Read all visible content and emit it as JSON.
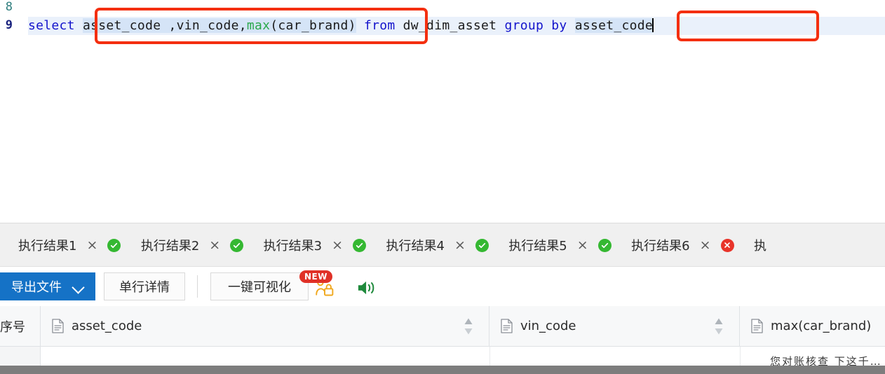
{
  "editor": {
    "line_numbers": [
      "8",
      "9"
    ],
    "sql": {
      "kw_select": "select",
      "col_asset_selected": "asset_code",
      "cols_mid": " ,vin_code,",
      "fn_max": "max",
      "max_args": "(car_brand)",
      "kw_from": "from",
      "table": "dw_dim_asset",
      "kw_group_by": "group by",
      "group_col": "asset_code"
    },
    "annotations": [
      {
        "name": "select-columns-highlight"
      },
      {
        "name": "group-by-column-highlight"
      }
    ]
  },
  "result_tabs": [
    {
      "label": "执行结果1",
      "close": "×",
      "status": "ok"
    },
    {
      "label": "执行结果2",
      "close": "×",
      "status": "ok"
    },
    {
      "label": "执行结果3",
      "close": "×",
      "status": "ok"
    },
    {
      "label": "执行结果4",
      "close": "×",
      "status": "ok"
    },
    {
      "label": "执行结果5",
      "close": "×",
      "status": "ok"
    },
    {
      "label": "执行结果6",
      "close": "×",
      "status": "err"
    },
    {
      "label": "执",
      "close": "",
      "status": "none"
    }
  ],
  "toolbar": {
    "export_label": "导出文件",
    "detail_label": "单行详情",
    "visualize_label": "一键可视化",
    "new_badge": "NEW",
    "lock_icon": "lock-person-icon",
    "speaker_icon": "speaker-icon"
  },
  "grid": {
    "index_header": "序号",
    "columns": [
      {
        "name": "asset_code",
        "sortable": true
      },
      {
        "name": "vin_code",
        "sortable": true
      },
      {
        "name": "max(car_brand)",
        "sortable": false
      }
    ],
    "rows": [
      {
        "asset_code": "",
        "vin_code": "",
        "max_car_brand": ""
      }
    ]
  },
  "watermark": {
    "text": "您对账核查 下这千…"
  },
  "colors": {
    "keyword": "#1414cc",
    "function": "#2aa84a",
    "annotation": "#f42f10",
    "export_button": "#1572c6",
    "status_ok": "#35b832",
    "status_error": "#e8342a",
    "badge_new": "#e03127"
  }
}
